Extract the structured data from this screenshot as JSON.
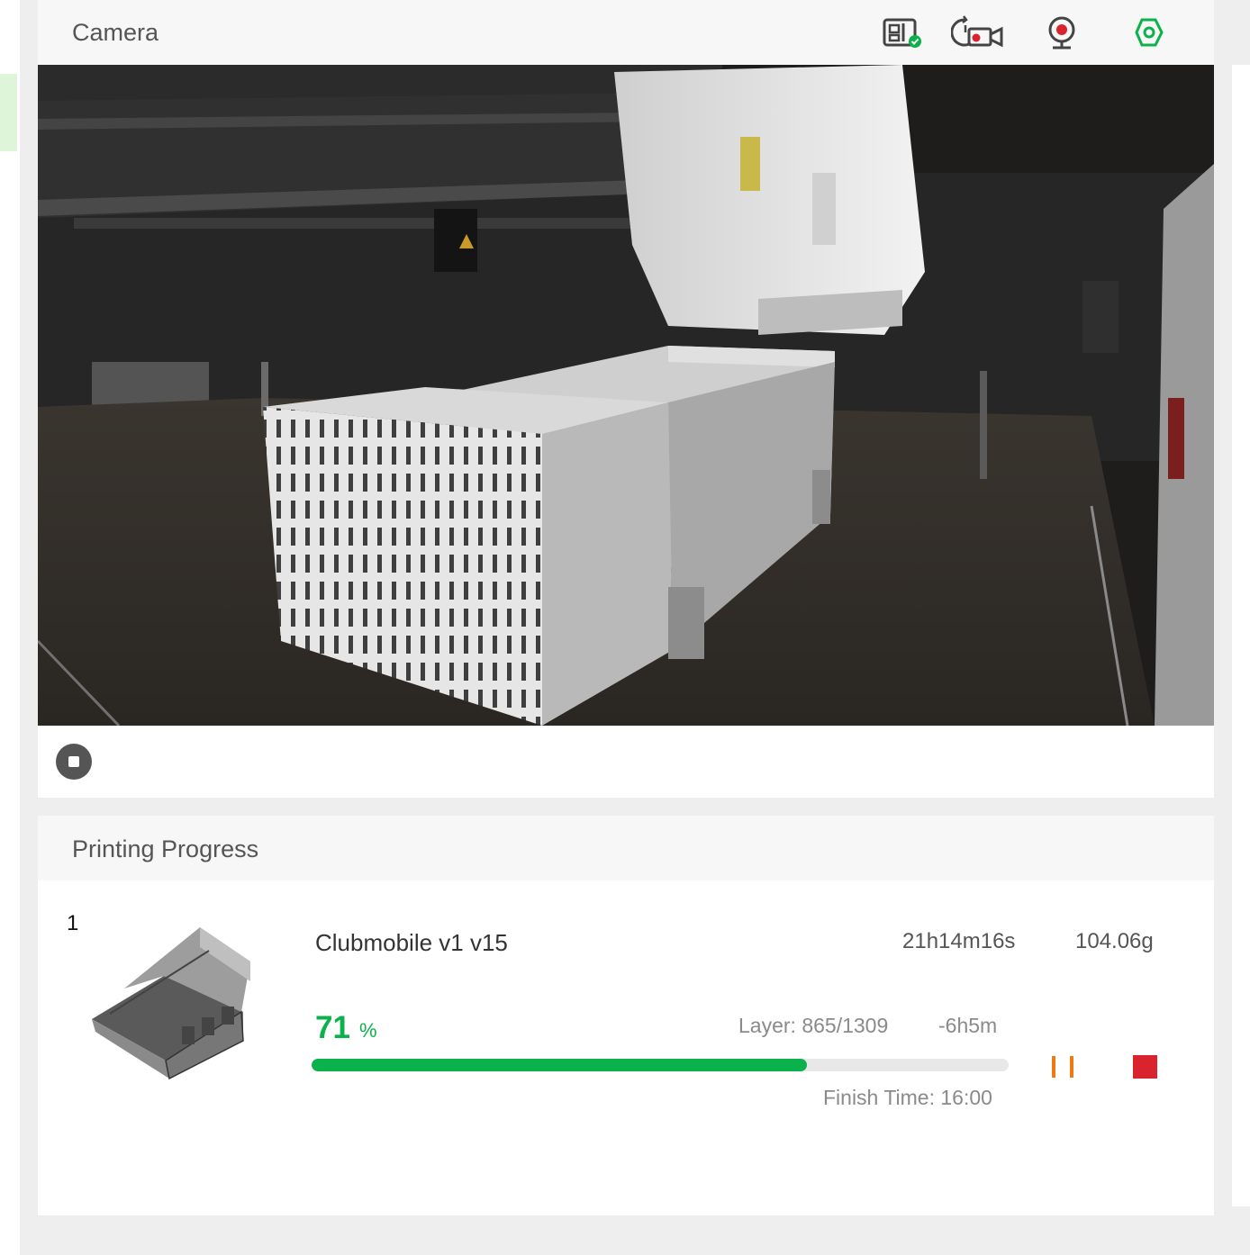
{
  "camera": {
    "title": "Camera",
    "icons": [
      "printer-status-icon",
      "timelapse-video-icon",
      "record-webcam-icon",
      "settings-hex-icon"
    ],
    "stream_control": "stop"
  },
  "progress": {
    "title": "Printing Progress",
    "job": {
      "index": "1",
      "name": "Clubmobile v1 v15",
      "duration": "21h14m16s",
      "weight": "104.06g",
      "percent": "71",
      "percent_sign": "%",
      "percent_value": 0.71,
      "layer": "Layer: 865/1309",
      "remaining": "-6h5m",
      "finish_time": "Finish Time: 16:00"
    }
  },
  "colors": {
    "accent_green": "#0bb14a",
    "pause_orange": "#f07a12",
    "stop_red": "#d9232d"
  }
}
